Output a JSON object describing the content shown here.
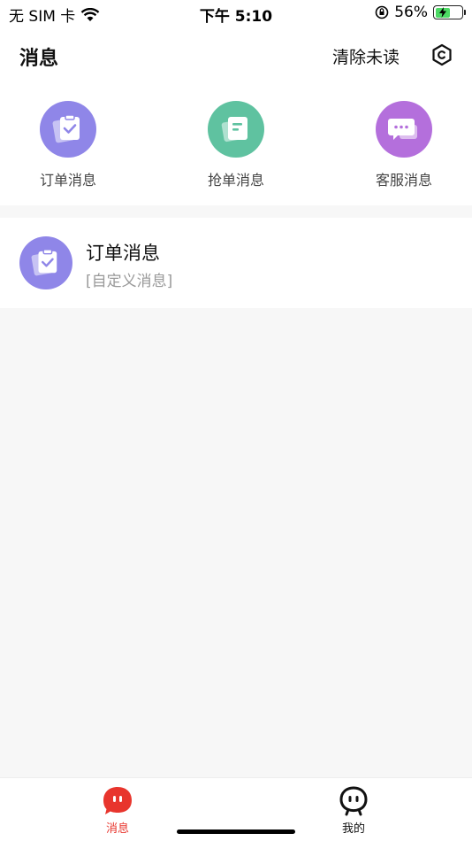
{
  "status_bar": {
    "carrier": "无 SIM 卡",
    "time": "下午 5:10",
    "battery_percent": "56%",
    "battery_level": 0.56
  },
  "header": {
    "title": "消息",
    "clear_label": "清除未读",
    "settings_icon": "hexagon-settings-icon"
  },
  "categories": [
    {
      "label": "订单消息",
      "icon": "clipboard-check-icon",
      "color": "#8f86e8"
    },
    {
      "label": "抢单消息",
      "icon": "document-icon",
      "color": "#5fc2a0"
    },
    {
      "label": "客服消息",
      "icon": "chat-bubble-icon",
      "color": "#b46fdc"
    }
  ],
  "messages": [
    {
      "title": "订单消息",
      "subtitle": "[自定义消息]",
      "icon": "clipboard-check-icon",
      "color": "#8f86e8"
    }
  ],
  "tabs": [
    {
      "label": "消息",
      "active": true,
      "icon": "message-face-icon",
      "color": "#e8352d"
    },
    {
      "label": "我的",
      "active": false,
      "icon": "profile-face-icon",
      "color": "#111111"
    }
  ]
}
